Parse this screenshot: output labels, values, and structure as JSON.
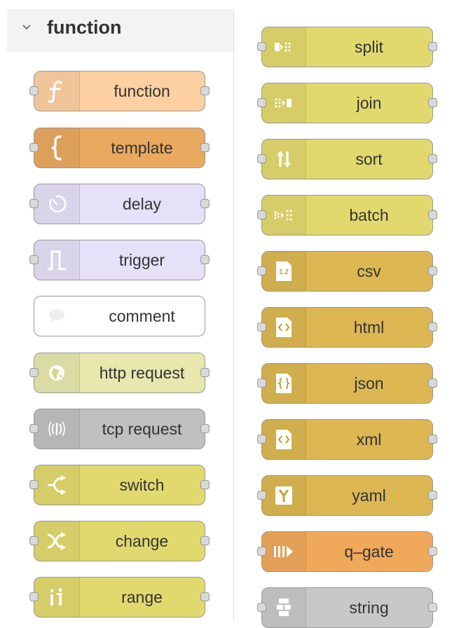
{
  "category": {
    "title": "function",
    "expanded": true
  },
  "left_nodes": [
    {
      "label": "function",
      "icon": "function-icon",
      "color": "#fdd0a2"
    },
    {
      "label": "template",
      "icon": "template-icon",
      "color": "#e9a95f"
    },
    {
      "label": "delay",
      "icon": "timer-icon",
      "color": "#e6e0f8"
    },
    {
      "label": "trigger",
      "icon": "trigger-icon",
      "color": "#e6e0f8"
    },
    {
      "label": "comment",
      "icon": "comment-icon",
      "color": "#ffffff"
    },
    {
      "label": "http request",
      "icon": "globe-icon",
      "color": "#e7e7ae"
    },
    {
      "label": "tcp request",
      "icon": "wireless-icon",
      "color": "#c0c0c0"
    },
    {
      "label": "switch",
      "icon": "switch-icon",
      "color": "#e2d96e"
    },
    {
      "label": "change",
      "icon": "shuffle-icon",
      "color": "#e2d96e"
    },
    {
      "label": "range",
      "icon": "range-icon",
      "color": "#e2d96e"
    }
  ],
  "right_nodes": [
    {
      "label": "split",
      "icon": "split-icon",
      "color": "#e2d96e"
    },
    {
      "label": "join",
      "icon": "join-icon",
      "color": "#e2d96e"
    },
    {
      "label": "sort",
      "icon": "sort-icon",
      "color": "#e2d96e"
    },
    {
      "label": "batch",
      "icon": "batch-icon",
      "color": "#e2d96e"
    },
    {
      "label": "csv",
      "icon": "csv-icon",
      "color": "#dcb752"
    },
    {
      "label": "html",
      "icon": "html-icon",
      "color": "#dcb752"
    },
    {
      "label": "json",
      "icon": "json-icon",
      "color": "#dcb752"
    },
    {
      "label": "xml",
      "icon": "xml-icon",
      "color": "#dcb752"
    },
    {
      "label": "yaml",
      "icon": "yaml-icon",
      "color": "#dcb752"
    },
    {
      "label": "q–gate",
      "icon": "gate-icon",
      "color": "#f0a85a"
    },
    {
      "label": "string",
      "icon": "string-icon",
      "color": "#c8c8c8"
    }
  ],
  "icon_text": {
    "csv": "1.2"
  }
}
